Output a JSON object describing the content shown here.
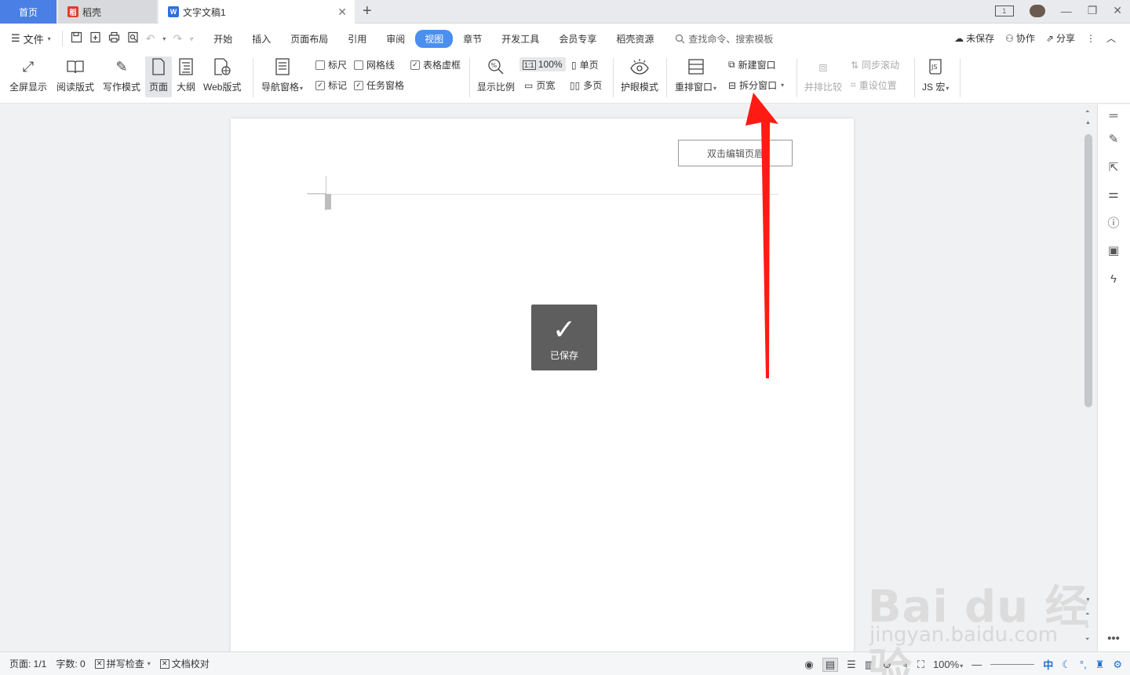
{
  "tabs": {
    "home": "首页",
    "daoke": "稻壳",
    "doc": "文字文稿1",
    "doc_icon": "W",
    "add": "+",
    "close": "✕"
  },
  "window": {
    "layout_label": "1",
    "minimize": "—",
    "restore": "❐",
    "close": "✕"
  },
  "menu": {
    "file": "文件",
    "tabs": [
      "开始",
      "插入",
      "页面布局",
      "引用",
      "审阅",
      "视图",
      "章节",
      "开发工具",
      "会员专享",
      "稻壳资源"
    ],
    "active_tab": "视图",
    "search": "查找命令、搜索模板",
    "unsaved": "未保存",
    "collab": "协作",
    "share": "分享"
  },
  "ribbon": {
    "fullscreen": "全屏显示",
    "read_mode": "阅读版式",
    "write_mode": "写作模式",
    "page": "页面",
    "outline": "大纲",
    "web_layout": "Web版式",
    "nav_pane": "导航窗格",
    "ruler": "标尺",
    "gridlines": "网格线",
    "table_borders": "表格虚框",
    "marks": "标记",
    "task_pane": "任务窗格",
    "zoom_ratio": "显示比例",
    "zoom_100": "100%",
    "zoom_11": "1:1",
    "page_width": "页宽",
    "single_page": "单页",
    "multi_page": "多页",
    "eye_mode": "护眼模式",
    "rearrange": "重排窗口",
    "new_window": "新建窗口",
    "split_window": "拆分窗口",
    "side_by_side": "并排比较",
    "sync_scroll": "同步滚动",
    "reset_position": "重设位置",
    "js_macro": "JS 宏"
  },
  "checkboxes": {
    "ruler": false,
    "gridlines": false,
    "table_borders": true,
    "marks": true,
    "task_pane": true
  },
  "document": {
    "header_hint": "双击编辑页眉",
    "saved_toast": "已保存"
  },
  "status": {
    "page": "页面: 1/1",
    "words": "字数: 0",
    "spell_check": "拼写检查",
    "doc_proof": "文档校对",
    "zoom": "100%",
    "ime": "中"
  },
  "watermark": {
    "big": "Bai du 经验",
    "small": "jingyan.baidu.com"
  },
  "colors": {
    "accent": "#4a8ef0",
    "home_tab": "#4a7fe6",
    "arrow": "#e8201c"
  }
}
